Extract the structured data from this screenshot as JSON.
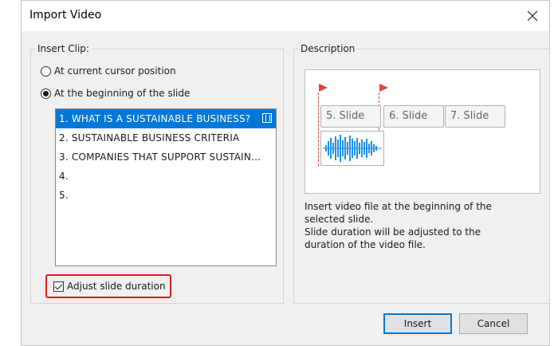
{
  "dialog": {
    "title": "Import Video"
  },
  "insert_clip": {
    "legend": "Insert Clip:",
    "options": [
      {
        "label": "At current cursor position",
        "checked": false
      },
      {
        "label": "At the beginning of the slide",
        "checked": true
      }
    ],
    "slides": [
      {
        "label": "1. WHAT IS A SUSTAINABLE BUSINESS?",
        "selected": true,
        "has_video": true
      },
      {
        "label": "2. SUSTAINABLE BUSINESS CRITERIA",
        "selected": false,
        "has_video": false
      },
      {
        "label": "3. COMPANIES THAT SUPPORT SUSTAIN...",
        "selected": false,
        "has_video": false
      },
      {
        "label": "4.",
        "selected": false,
        "has_video": false
      },
      {
        "label": "5.",
        "selected": false,
        "has_video": false
      }
    ],
    "adjust_duration": {
      "label": "Adjust slide duration",
      "checked": true
    }
  },
  "description": {
    "legend": "Description",
    "slides": [
      "5. Slide",
      "6. Slide",
      "7. Slide"
    ],
    "text_lines": [
      "Insert video file at the beginning of the",
      "selected slide.",
      "Slide duration will be adjusted to the",
      "duration of the video file."
    ]
  },
  "buttons": {
    "insert": "Insert",
    "cancel": "Cancel"
  },
  "colors": {
    "selection": "#0078d7",
    "highlight_border": "#d81e1e",
    "marker": "#e8413c",
    "waveform": "#1e90e6"
  },
  "icons": {
    "close": "close-icon",
    "film": "film-icon",
    "marker": "flag-marker-icon",
    "waveform": "audio-waveform-icon"
  }
}
